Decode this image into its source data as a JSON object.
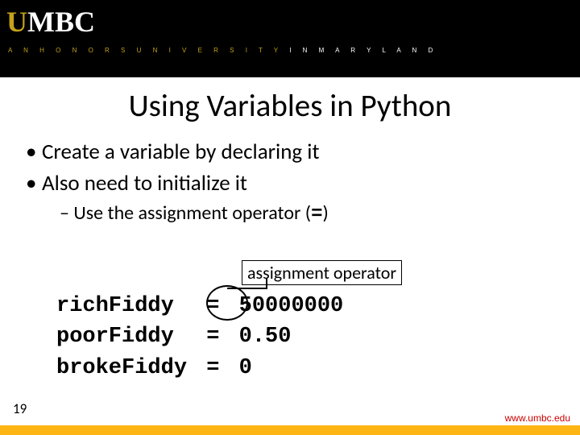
{
  "header": {
    "logo_bold": "U",
    "logo_rest": "MBC",
    "tag_a": "A N   H O N O R S   U N I V E R S I T Y",
    "tag_b": "   I N   M A R Y L A N D"
  },
  "title": "Using Variables in Python",
  "bullets": {
    "b1": "Create a variable by declaring it",
    "b2": "Also need to initialize it",
    "sub": "– Use the assignment operator (",
    "sub_op": "=",
    "sub_end": ")"
  },
  "annotation": "assignment operator",
  "code": {
    "r1": {
      "v": "richFiddy  ",
      "e": "=",
      "val": " 50000000"
    },
    "r2": {
      "v": "poorFiddy  ",
      "e": "=",
      "val": " 0.50"
    },
    "r3": {
      "v": "brokeFiddy ",
      "e": "=",
      "val": " 0"
    }
  },
  "page": "19",
  "url": "www.umbc.edu"
}
